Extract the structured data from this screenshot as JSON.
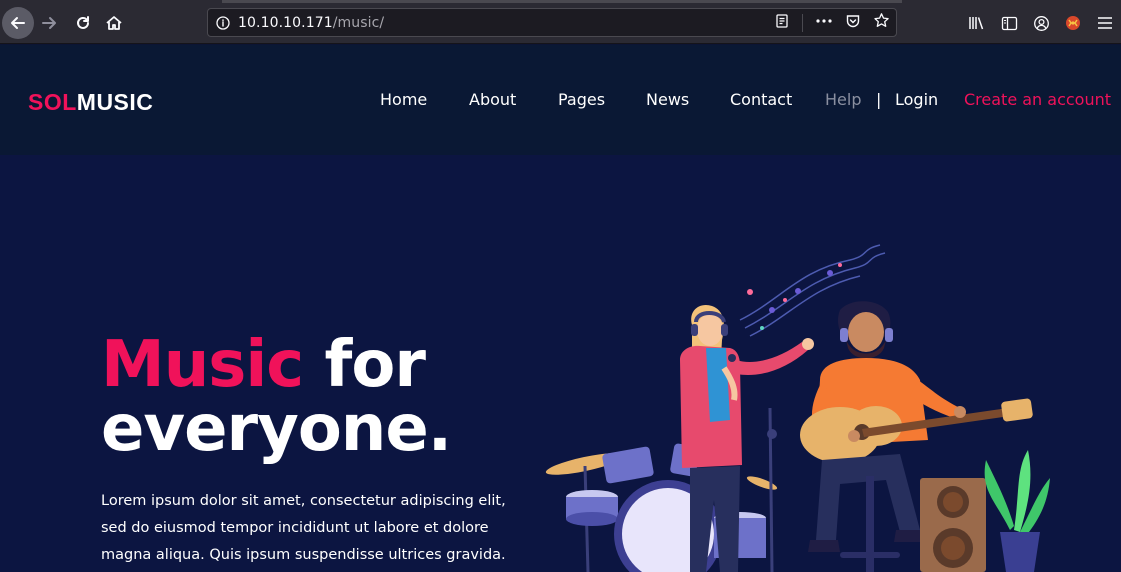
{
  "browser": {
    "url_host": "10.10.10.171",
    "url_path": "/music/"
  },
  "site": {
    "logo_accent": "SOL",
    "logo_main": "MUSIC",
    "nav": {
      "home": "Home",
      "about": "About",
      "pages": "Pages",
      "news": "News",
      "contact": "Contact",
      "help": "Help",
      "separator": "|",
      "login": "Login",
      "create_account": "Create an account"
    }
  },
  "hero": {
    "title_accent": "Music",
    "title_rest_1": " for",
    "title_line_2": "everyone.",
    "text_line_1": "Lorem ipsum dolor sit amet, consectetur adipiscing elit,",
    "text_line_2": "sed do eiusmod tempor incididunt ut labore et dolore",
    "text_line_3": "magna aliqua. Quis ipsum suspendisse ultrices gravida."
  },
  "colors": {
    "accent": "#f0125a",
    "header_bg": "#0a1834",
    "hero_bg": "#0c1541"
  }
}
